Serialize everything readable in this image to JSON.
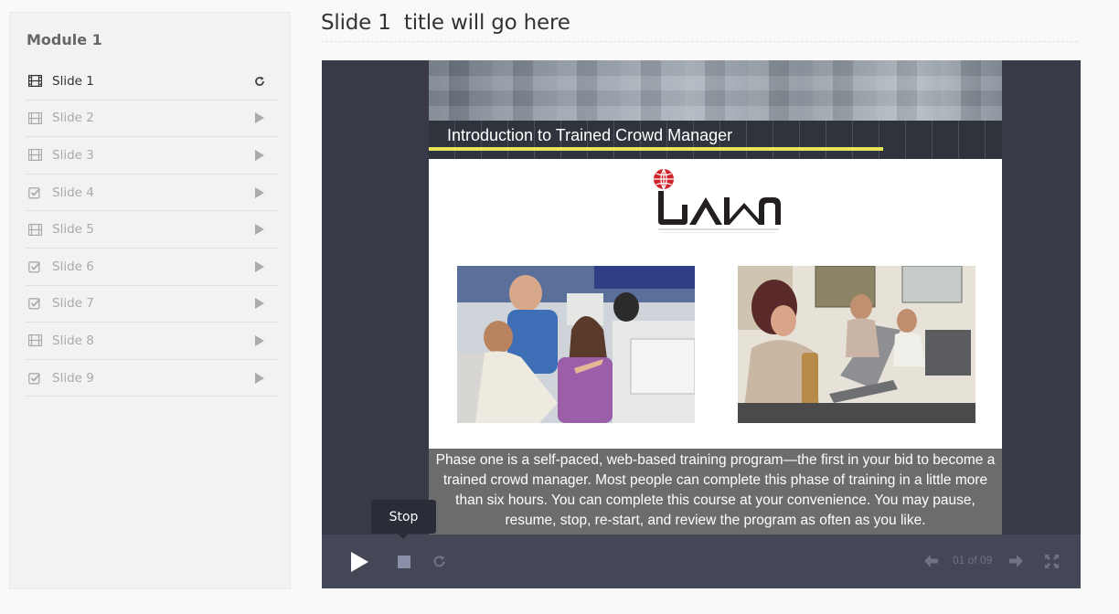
{
  "sidebar": {
    "module_title": "Module 1",
    "items": [
      {
        "label": "Slide 1",
        "type": "film-icon",
        "action": "refresh-icon",
        "active": true
      },
      {
        "label": "Slide 2",
        "type": "film-icon",
        "action": "play-icon",
        "active": false
      },
      {
        "label": "Slide 3",
        "type": "film-icon",
        "action": "play-icon",
        "active": false
      },
      {
        "label": "Slide 4",
        "type": "checkbox-icon",
        "action": "play-icon",
        "active": false
      },
      {
        "label": "Slide 5",
        "type": "film-icon",
        "action": "play-icon",
        "active": false
      },
      {
        "label": "Slide 6",
        "type": "checkbox-icon",
        "action": "play-icon",
        "active": false
      },
      {
        "label": "Slide 7",
        "type": "checkbox-icon",
        "action": "play-icon",
        "active": false
      },
      {
        "label": "Slide 8",
        "type": "film-icon",
        "action": "play-icon",
        "active": false
      },
      {
        "label": "Slide 9",
        "type": "checkbox-icon",
        "action": "play-icon",
        "active": false
      }
    ]
  },
  "header": {
    "title": "Slide 1  title will go here"
  },
  "slide": {
    "banner_title": "Introduction to Trained Crowd Manager",
    "caption": "Phase one is a self-paced, web-based training program—the first in your bid to become a trained crowd manager.  Most people can complete this phase of training in a little more than six hours.  You can complete this course at your convenience.  You may pause, resume, stop, re-start, and review the program as often as you like."
  },
  "controls": {
    "page_counter": "01 of 09",
    "tooltip": "Stop"
  },
  "colors": {
    "player_bg": "#383a47",
    "controls_bg": "#444756",
    "accent_yellow": "#e8e35a",
    "logo_red": "#d2232a"
  }
}
